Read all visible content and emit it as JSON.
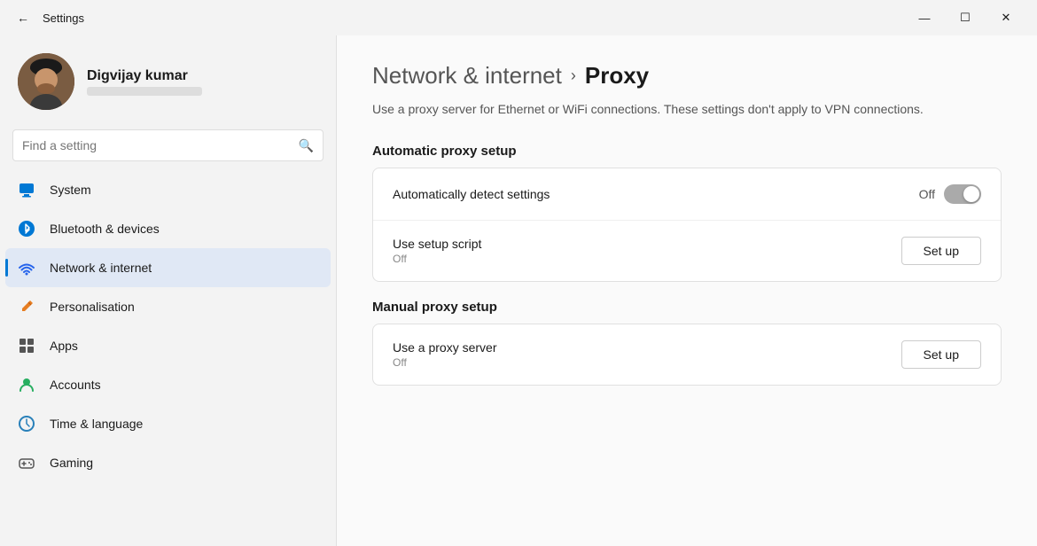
{
  "window": {
    "title": "Settings",
    "controls": {
      "minimize": "—",
      "maximize": "☐",
      "close": "✕"
    }
  },
  "profile": {
    "name": "Digvijay kumar",
    "email": "••••••••••••••••••••"
  },
  "search": {
    "placeholder": "Find a setting"
  },
  "nav": {
    "items": [
      {
        "id": "system",
        "label": "System",
        "icon": "💻",
        "active": false
      },
      {
        "id": "bluetooth",
        "label": "Bluetooth & devices",
        "icon": "🔷",
        "active": false
      },
      {
        "id": "network",
        "label": "Network & internet",
        "icon": "📶",
        "active": true
      },
      {
        "id": "personalisation",
        "label": "Personalisation",
        "icon": "✏️",
        "active": false
      },
      {
        "id": "apps",
        "label": "Apps",
        "icon": "📦",
        "active": false
      },
      {
        "id": "accounts",
        "label": "Accounts",
        "icon": "👤",
        "active": false
      },
      {
        "id": "time",
        "label": "Time & language",
        "icon": "🌐",
        "active": false
      },
      {
        "id": "gaming",
        "label": "Gaming",
        "icon": "🎮",
        "active": false
      }
    ]
  },
  "content": {
    "breadcrumb_parent": "Network & internet",
    "breadcrumb_chevron": "›",
    "breadcrumb_current": "Proxy",
    "description": "Use a proxy server for Ethernet or WiFi connections. These settings don't apply to VPN connections.",
    "sections": [
      {
        "title": "Automatic proxy setup",
        "rows": [
          {
            "label": "Automatically detect settings",
            "sublabel": "",
            "control_type": "toggle",
            "toggle_state": "Off"
          },
          {
            "label": "Use setup script",
            "sublabel": "Off",
            "control_type": "button",
            "button_label": "Set up"
          }
        ]
      },
      {
        "title": "Manual proxy setup",
        "rows": [
          {
            "label": "Use a proxy server",
            "sublabel": "Off",
            "control_type": "button",
            "button_label": "Set up"
          }
        ]
      }
    ]
  }
}
